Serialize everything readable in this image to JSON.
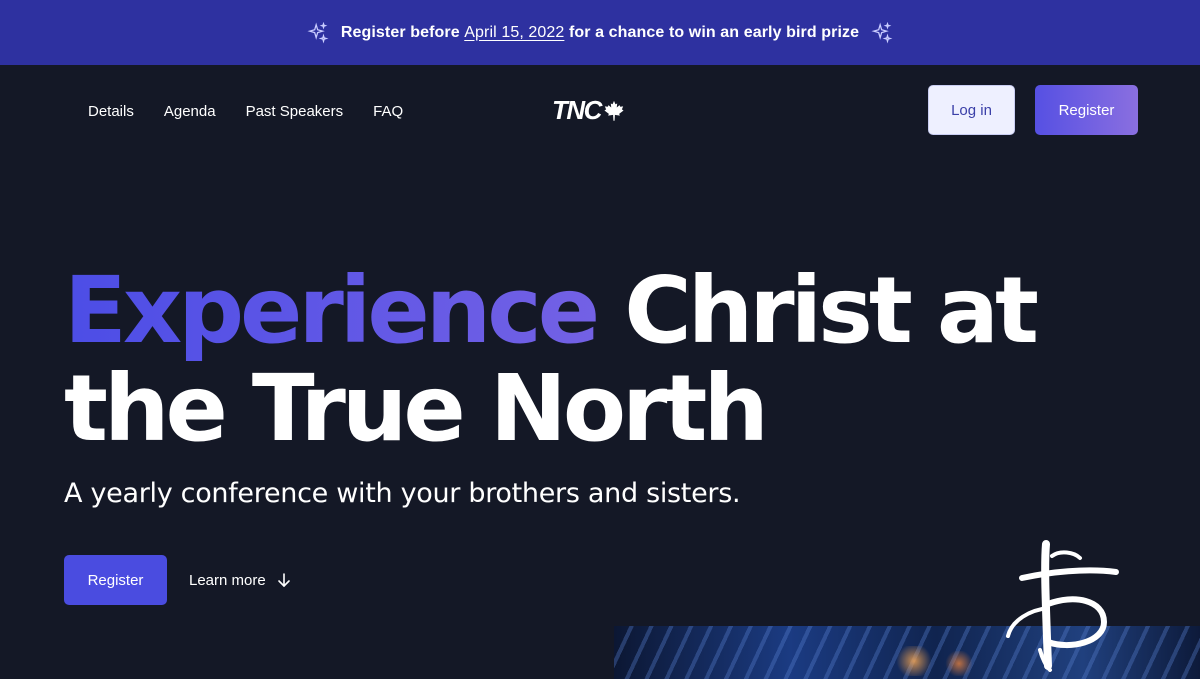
{
  "banner": {
    "text_before": "Register before ",
    "date_link": "April 15, 2022",
    "text_after": " for a chance to win an early bird prize",
    "icon": "sparkle-icon"
  },
  "nav": {
    "links": [
      "Details",
      "Agenda",
      "Past Speakers",
      "FAQ"
    ],
    "logo_text": "TNC",
    "logo_icon": "maple-leaf-icon",
    "login_label": "Log in",
    "register_label": "Register"
  },
  "hero": {
    "title_accent": "Experience",
    "title_rest_line1": " Christ at",
    "title_line2": "the True North",
    "subtitle": "A yearly conference with your brothers and sisters.",
    "register_label": "Register",
    "learn_more_label": "Learn more",
    "learn_more_icon": "arrow-down-icon"
  },
  "colors": {
    "background": "#141826",
    "banner": "#2e31a0",
    "accent": "#4c4de6",
    "accent_end": "#7361e5",
    "login_bg": "#eef0ff"
  }
}
